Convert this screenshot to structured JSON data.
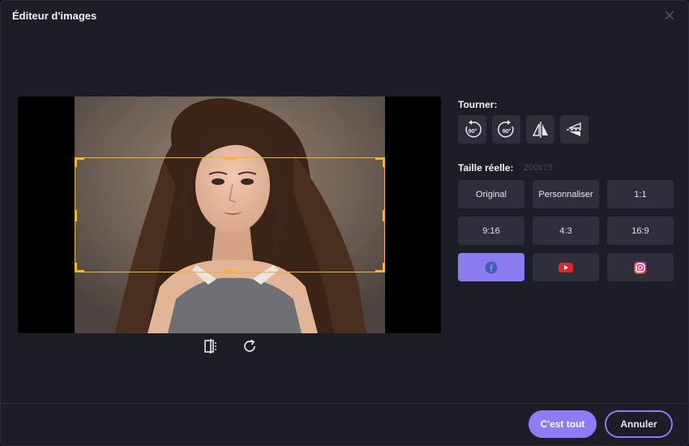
{
  "dialog": {
    "title": "Éditeur d'images"
  },
  "icons": {
    "close": "close-icon",
    "crop_toggle": "crop-icon",
    "reset": "refresh-icon"
  },
  "rotate": {
    "label": "Tourner:",
    "buttons": [
      {
        "name": "rotate-left",
        "text": "90°"
      },
      {
        "name": "rotate-right",
        "text": "90°"
      },
      {
        "name": "flip-horizontal",
        "text": ""
      },
      {
        "name": "flip-vertical",
        "text": ""
      }
    ]
  },
  "size": {
    "label": "Taille réelle:",
    "value": "200x75"
  },
  "ratios": [
    {
      "label": "Original"
    },
    {
      "label": "Personnaliser"
    },
    {
      "label": "1:1"
    },
    {
      "label": "9:16"
    },
    {
      "label": "4:3"
    },
    {
      "label": "16:9"
    }
  ],
  "social": [
    {
      "name": "facebook",
      "icon": "facebook-icon",
      "color": "#3f5fb5",
      "active": true
    },
    {
      "name": "youtube",
      "icon": "youtube-icon",
      "color": "#e0262c",
      "active": false
    },
    {
      "name": "instagram",
      "icon": "instagram-icon",
      "color": "#e1306c",
      "active": false
    }
  ],
  "footer": {
    "confirm_label": "C'est tout",
    "cancel_label": "Annuler"
  },
  "colors": {
    "accent": "#8d7cf6",
    "crop": "#f5b82a"
  }
}
